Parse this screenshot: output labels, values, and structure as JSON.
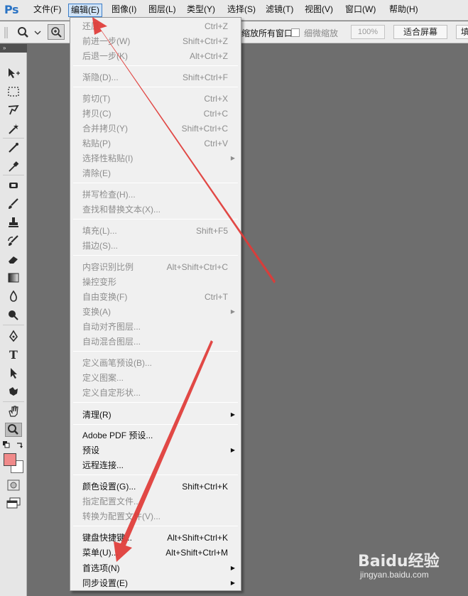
{
  "app": {
    "logo": "Ps"
  },
  "menubar": {
    "items": [
      "文件(F)",
      "编辑(E)",
      "图像(I)",
      "图层(L)",
      "类型(Y)",
      "选择(S)",
      "滤镜(T)",
      "视图(V)",
      "窗口(W)",
      "帮助(H)"
    ],
    "active": "编辑(E)"
  },
  "options": {
    "all_windows": "缩放所有窗口",
    "scrubby_zoom": "细微缩放",
    "zoom_value": "100%",
    "fit_screen": "适合屏幕",
    "fill_screen": "填"
  },
  "edit_menu": {
    "items": [
      {
        "label": "还原",
        "shortcut": "Ctrl+Z",
        "enabled": false
      },
      {
        "label": "前进一步(W)",
        "shortcut": "Shift+Ctrl+Z",
        "enabled": false
      },
      {
        "label": "后退一步(K)",
        "shortcut": "Alt+Ctrl+Z",
        "enabled": false
      },
      {
        "label": "渐隐(D)...",
        "shortcut": "Shift+Ctrl+F",
        "enabled": false
      },
      {
        "label": "剪切(T)",
        "shortcut": "Ctrl+X",
        "enabled": false
      },
      {
        "label": "拷贝(C)",
        "shortcut": "Ctrl+C",
        "enabled": false
      },
      {
        "label": "合并拷贝(Y)",
        "shortcut": "Shift+Ctrl+C",
        "enabled": false
      },
      {
        "label": "粘贴(P)",
        "shortcut": "Ctrl+V",
        "enabled": false
      },
      {
        "label": "选择性粘贴(I)",
        "shortcut": "",
        "enabled": false,
        "submenu": true
      },
      {
        "label": "清除(E)",
        "shortcut": "",
        "enabled": false
      },
      {
        "label": "拼写检查(H)...",
        "shortcut": "",
        "enabled": false
      },
      {
        "label": "查找和替换文本(X)...",
        "shortcut": "",
        "enabled": false
      },
      {
        "label": "填充(L)...",
        "shortcut": "Shift+F5",
        "enabled": false
      },
      {
        "label": "描边(S)...",
        "shortcut": "",
        "enabled": false
      },
      {
        "label": "内容识别比例",
        "shortcut": "Alt+Shift+Ctrl+C",
        "enabled": false
      },
      {
        "label": "操控变形",
        "shortcut": "",
        "enabled": false
      },
      {
        "label": "自由变换(F)",
        "shortcut": "Ctrl+T",
        "enabled": false
      },
      {
        "label": "变换(A)",
        "shortcut": "",
        "enabled": false,
        "submenu": true
      },
      {
        "label": "自动对齐图层...",
        "shortcut": "",
        "enabled": false
      },
      {
        "label": "自动混合图层...",
        "shortcut": "",
        "enabled": false
      },
      {
        "label": "定义画笔预设(B)...",
        "shortcut": "",
        "enabled": false
      },
      {
        "label": "定义图案...",
        "shortcut": "",
        "enabled": false
      },
      {
        "label": "定义自定形状...",
        "shortcut": "",
        "enabled": false
      },
      {
        "label": "清理(R)",
        "shortcut": "",
        "enabled": true,
        "submenu": true
      },
      {
        "label": "Adobe PDF 预设...",
        "shortcut": "",
        "enabled": true
      },
      {
        "label": "预设",
        "shortcut": "",
        "enabled": true,
        "submenu": true
      },
      {
        "label": "远程连接...",
        "shortcut": "",
        "enabled": true
      },
      {
        "label": "颜色设置(G)...",
        "shortcut": "Shift+Ctrl+K",
        "enabled": true
      },
      {
        "label": "指定配置文件...",
        "shortcut": "",
        "enabled": false
      },
      {
        "label": "转换为配置文件(V)...",
        "shortcut": "",
        "enabled": false
      },
      {
        "label": "键盘快捷键...",
        "shortcut": "Alt+Shift+Ctrl+K",
        "enabled": true
      },
      {
        "label": "菜单(U)...",
        "shortcut": "Alt+Shift+Ctrl+M",
        "enabled": true
      },
      {
        "label": "首选项(N)",
        "shortcut": "",
        "enabled": true,
        "submenu": true
      },
      {
        "label": "同步设置(E)",
        "shortcut": "",
        "enabled": true,
        "submenu": true
      }
    ]
  },
  "tools": [
    "move-tool",
    "marquee-tool",
    "lasso-tool",
    "magic-wand-tool",
    "crop-tool",
    "eyedropper-tool",
    "healing-brush-tool",
    "brush-tool",
    "clone-stamp-tool",
    "history-brush-tool",
    "eraser-tool",
    "gradient-tool",
    "blur-tool",
    "dodge-tool",
    "pen-tool",
    "type-tool",
    "path-selection-tool",
    "shape-tool",
    "hand-tool",
    "zoom-tool"
  ],
  "colors": {
    "foreground": "#f08a8a",
    "background": "#ffffff",
    "annotation_arrow": "#e03a36",
    "menu_highlight": "#cfe3f7"
  },
  "watermark": {
    "logo": "Baidu经验",
    "url": "jingyan.baidu.com"
  }
}
